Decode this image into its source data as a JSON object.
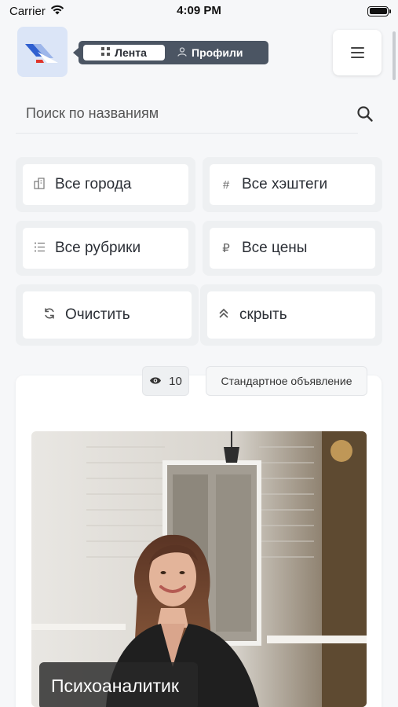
{
  "status_bar": {
    "carrier": "Carrier",
    "time": "4:09 PM"
  },
  "nav": {
    "tabs": [
      {
        "label": "Лента",
        "icon": "grid-icon",
        "active": true
      },
      {
        "label": "Профили",
        "icon": "user-icon",
        "active": false
      }
    ],
    "menu_icon": "hamburger-icon"
  },
  "search": {
    "placeholder": "Поиск по названиям"
  },
  "filters": {
    "cities": {
      "label": "Все города",
      "icon": "buildings-icon"
    },
    "hashtags": {
      "label": "Все хэштеги",
      "icon": "hash-icon"
    },
    "rubrics": {
      "label": "Все рубрики",
      "icon": "list-icon"
    },
    "prices": {
      "label": "Все цены",
      "icon": "ruble-icon"
    },
    "clear": {
      "label": "Очистить",
      "icon": "refresh-icon"
    },
    "hide": {
      "label": "скрыть",
      "icon": "chevrons-up-icon"
    }
  },
  "card": {
    "views": "10",
    "type": "Стандартное объявление",
    "caption": "Психоаналитик"
  },
  "colors": {
    "background": "#f6f7f9",
    "pill": "#4b5563",
    "logo_bg": "#dbe5f7",
    "logo_blue": "#2f5fd0",
    "logo_red": "#e0352b"
  }
}
